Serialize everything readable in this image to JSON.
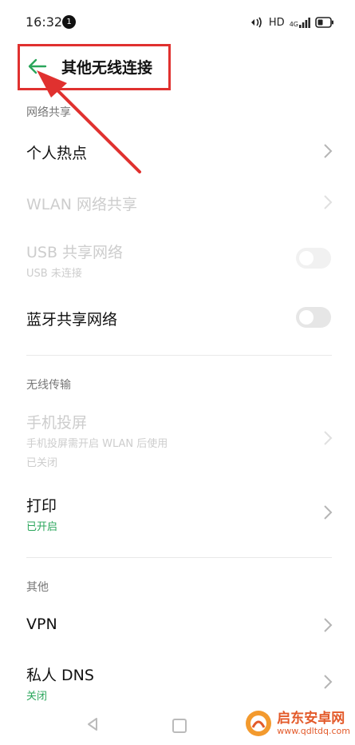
{
  "status_bar": {
    "time": "16:32",
    "notification_count": "1",
    "hd": "HD",
    "network": "4G"
  },
  "header": {
    "title": "其他无线连接"
  },
  "sections": {
    "network_share": {
      "header": "网络共享",
      "hotspot": "个人热点",
      "wlan_share": "WLAN 网络共享",
      "usb_share": "USB 共享网络",
      "usb_share_status": "USB 未连接",
      "bt_share": "蓝牙共享网络"
    },
    "wireless_transfer": {
      "header": "无线传输",
      "screen_cast": "手机投屏",
      "screen_cast_hint": "手机投屏需开启 WLAN 后使用",
      "screen_cast_status": "已关闭",
      "print": "打印",
      "print_status": "已开启"
    },
    "other": {
      "header": "其他",
      "vpn": "VPN",
      "private_dns": "私人 DNS",
      "private_dns_status": "关闭"
    }
  },
  "toggles": {
    "usb_share_on": false,
    "bt_share_on": false
  },
  "colors": {
    "accent_green": "#2aa65b",
    "annotation_red": "#e0312f",
    "disabled_text": "#cdcdcd"
  },
  "watermark": {
    "name": "启东安卓网",
    "url": "www.qdltdq.com"
  }
}
